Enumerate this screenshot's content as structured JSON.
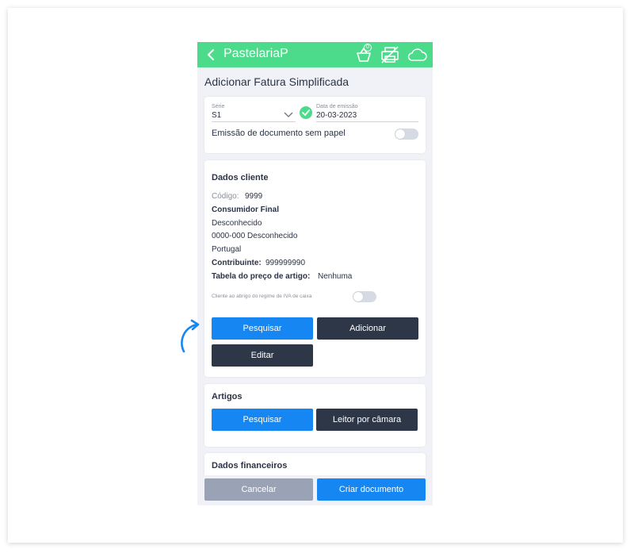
{
  "appbar": {
    "title": "PastelariaP",
    "basket_count": "0",
    "back_icon": "chevron-left-icon",
    "basket_icon": "basket-icon",
    "printer_icon": "no-print-icon",
    "cloud_icon": "cloud-icon",
    "color": "#4cdb8a"
  },
  "page_title": "Adicionar Fatura Simplificada",
  "document": {
    "serie_label": "Série",
    "serie_value": "S1",
    "date_label": "Data de emissão",
    "date_value": "20-03-2023",
    "paperless_label": "Emissão de documento sem papel",
    "paperless_on": false
  },
  "client": {
    "title": "Dados cliente",
    "code_label": "Código:",
    "code_value": "9999",
    "name": "Consumidor Final",
    "address": "Desconhecido",
    "postal": "0000-000  Desconhecido",
    "country": "Portugal",
    "nif_label": "Contribuinte:",
    "nif_value": "999999990",
    "price_table_label": "Tabela do preço de artigo:",
    "price_table_value": "Nenhuma",
    "iva_caixa_label": "Cliente ao abrigo do regime de IVA de caixa",
    "iva_caixa_on": false,
    "search_button": "Pesquisar",
    "add_button": "Adicionar",
    "edit_button": "Editar"
  },
  "articles": {
    "title": "Artigos",
    "search_button": "Pesquisar",
    "camera_button": "Leitor por câmara"
  },
  "financial": {
    "title": "Dados financeiros"
  },
  "footer": {
    "cancel_button": "Cancelar",
    "create_button": "Criar documento"
  },
  "colors": {
    "primary_blue": "#1586f2",
    "dark": "#2e3748",
    "annotation_arrow": "#1586f2"
  }
}
